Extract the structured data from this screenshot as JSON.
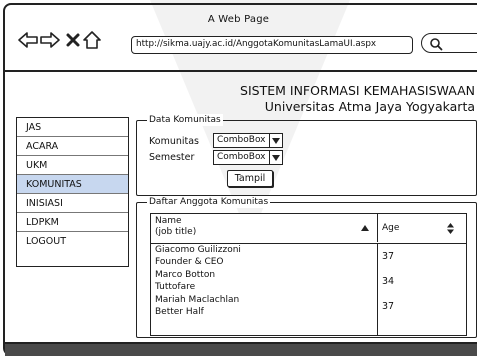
{
  "window": {
    "title": "A Web Page",
    "url": "http://sikma.uajy.ac.id/AnggotaKomunitasLamaUI.aspx"
  },
  "nav": {
    "back_icon": "back-arrow-icon",
    "forward_icon": "forward-arrow-icon",
    "close_icon": "close-icon",
    "home_icon": "home-icon",
    "search_icon": "search-icon"
  },
  "header": {
    "title": "SISTEM INFORMASI KEMAHASISWAAN",
    "subtitle": "Universitas Atma Jaya Yogyakarta"
  },
  "sidebar": {
    "items": [
      {
        "label": "JAS"
      },
      {
        "label": "ACARA"
      },
      {
        "label": "UKM"
      },
      {
        "label": "KOMUNITAS"
      },
      {
        "label": "INISIASI"
      },
      {
        "label": "LDPKM"
      },
      {
        "label": "LOGOUT"
      }
    ],
    "active_color": "#c7d7ef"
  },
  "data_komunitas": {
    "title": "Data Komunitas",
    "komunitas_label": "Komunitas",
    "komunitas_value": "ComboBox",
    "semester_label": "Semester",
    "semester_value": "ComboBox",
    "tampil_label": "Tampil"
  },
  "daftar_anggota": {
    "title": "Daftar Anggota Komunitas",
    "columns": {
      "name_line1": "Name",
      "name_line2": "(job title)",
      "age": "Age"
    },
    "rows": [
      {
        "name": "Giacomo Guilizzoni",
        "title": "Founder & CEO",
        "age": "37"
      },
      {
        "name": "Marco Botton",
        "title": "Tuttofare",
        "age": "34"
      },
      {
        "name": "Mariah Maclachlan",
        "title": "Better Half",
        "age": "37"
      }
    ]
  },
  "colors": {
    "footer": "#4a4a4a",
    "border": "#222222"
  }
}
